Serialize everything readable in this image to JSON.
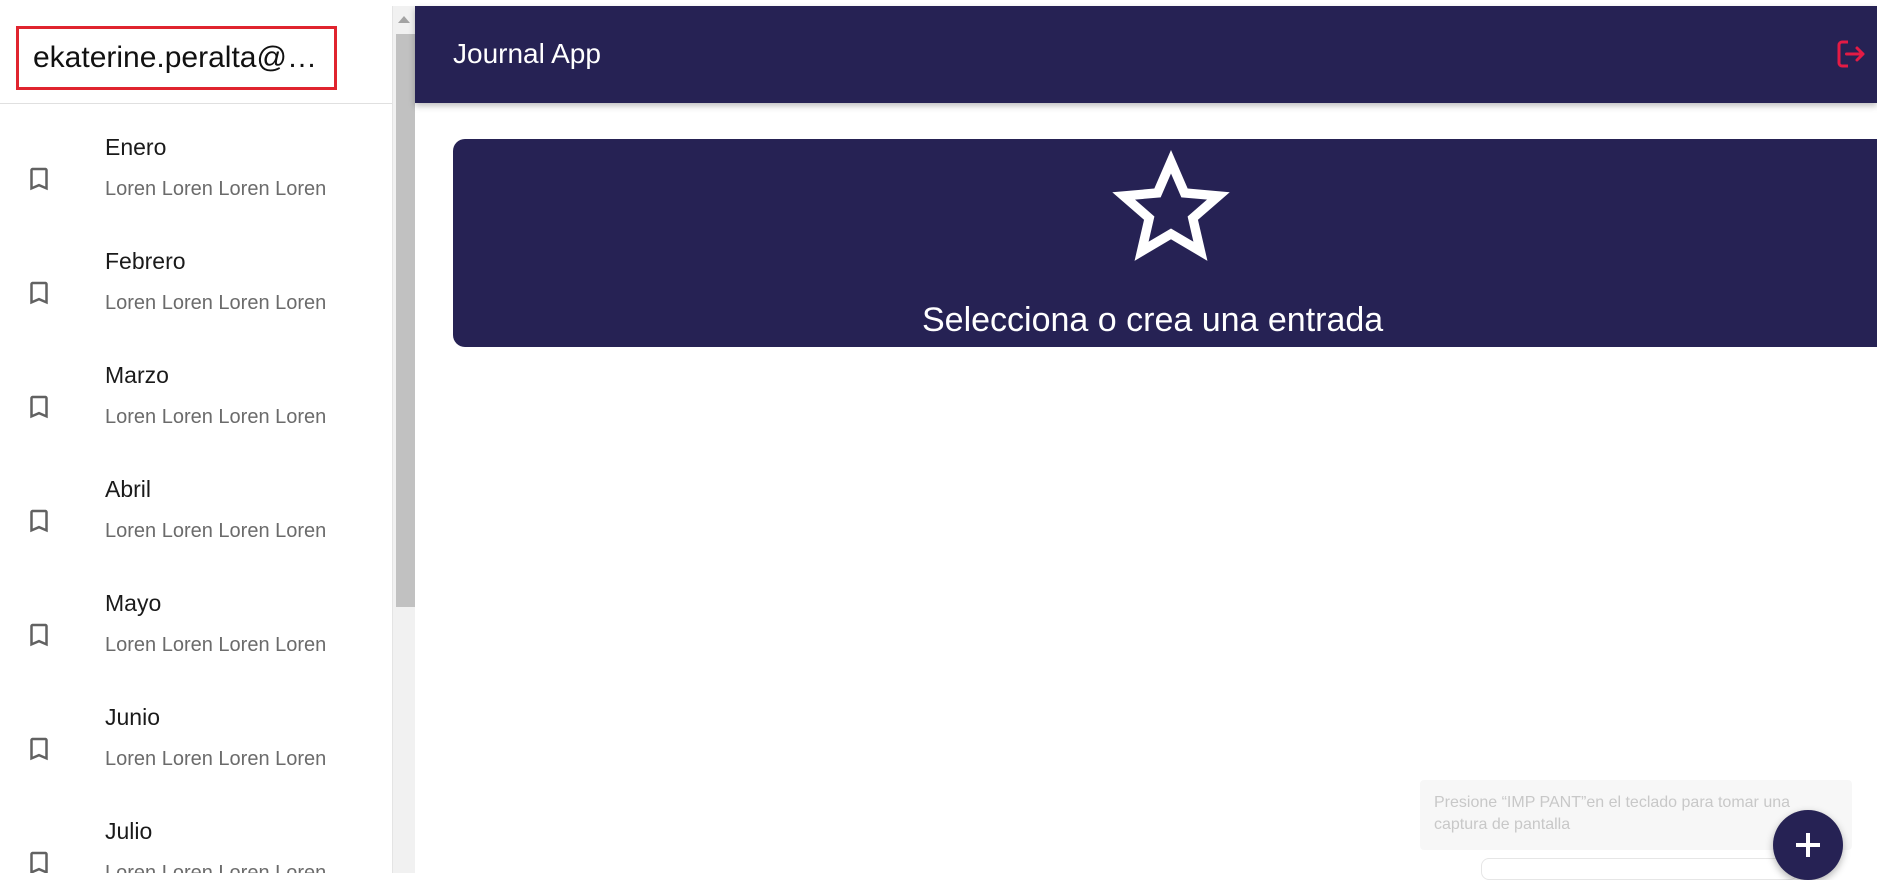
{
  "sidebar": {
    "user_email": "ekaterine.peralta@gmail.com",
    "entries": [
      {
        "title": "Enero",
        "body": "Loren Loren Loren Loren"
      },
      {
        "title": "Febrero",
        "body": "Loren Loren Loren Loren"
      },
      {
        "title": "Marzo",
        "body": "Loren Loren Loren Loren"
      },
      {
        "title": "Abril",
        "body": "Loren Loren Loren Loren"
      },
      {
        "title": "Mayo",
        "body": "Loren Loren Loren Loren"
      },
      {
        "title": "Junio",
        "body": "Loren Loren Loren Loren"
      },
      {
        "title": "Julio",
        "body": "Loren Loren Loren Loren"
      }
    ],
    "entry_icon": "bookmark-border-icon"
  },
  "appbar": {
    "title": "Journal App",
    "logout_icon": "logout-icon"
  },
  "main": {
    "nothing_selected_text": "Selecciona o crea una entrada",
    "star_icon": "star-outline-icon"
  },
  "toast": {
    "text": "Presione “IMP PANT”en el teclado para tomar una captura de pantalla"
  },
  "fab": {
    "icon": "plus-icon"
  },
  "colors": {
    "primary": "#262254",
    "error": "#e41b45",
    "highlight_border": "#e0242e"
  }
}
